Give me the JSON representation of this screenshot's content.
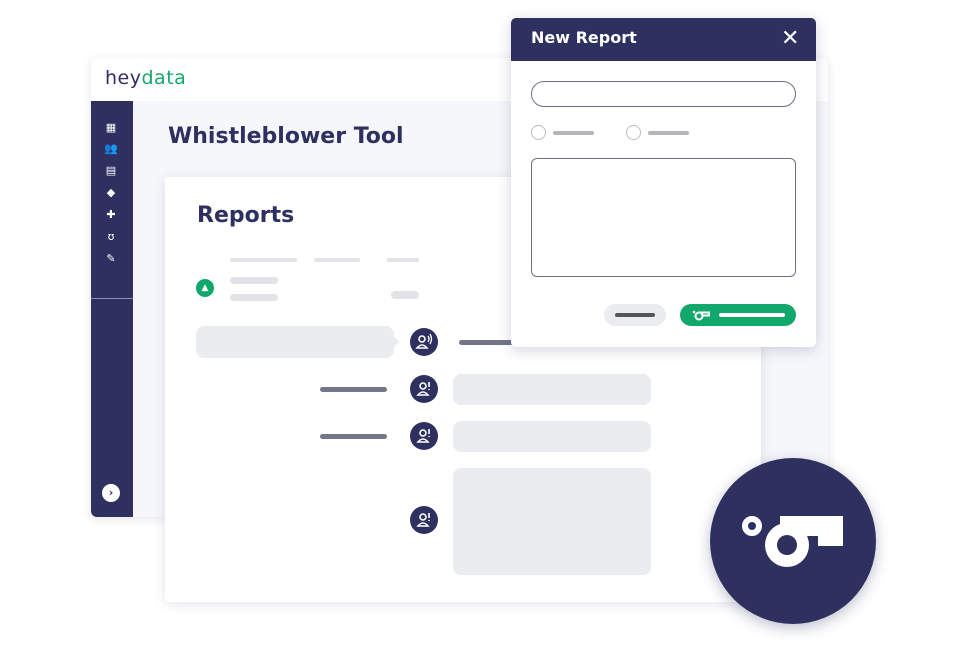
{
  "app": {
    "logo": {
      "prefix": "hey",
      "highlight": "data"
    },
    "title": "Whistleblower Tool"
  },
  "sidebar": {
    "items": [
      {
        "icon": "dashboard-icon"
      },
      {
        "icon": "users-icon"
      },
      {
        "icon": "clipboard-icon"
      },
      {
        "icon": "graduation-cap-icon"
      },
      {
        "icon": "puzzle-icon"
      },
      {
        "icon": "stethoscope-icon"
      },
      {
        "icon": "tool-icon"
      }
    ],
    "expand_icon": "chevron-right-icon"
  },
  "main": {
    "card_title": "Reports"
  },
  "modal": {
    "title": "New Report",
    "close_icon": "close-icon",
    "submit_icon": "whistle-icon"
  },
  "colors": {
    "navy": "#2e3060",
    "green": "#13a86b",
    "bubble": "#ebecf0"
  },
  "badge": {
    "icon": "whistle-icon"
  }
}
